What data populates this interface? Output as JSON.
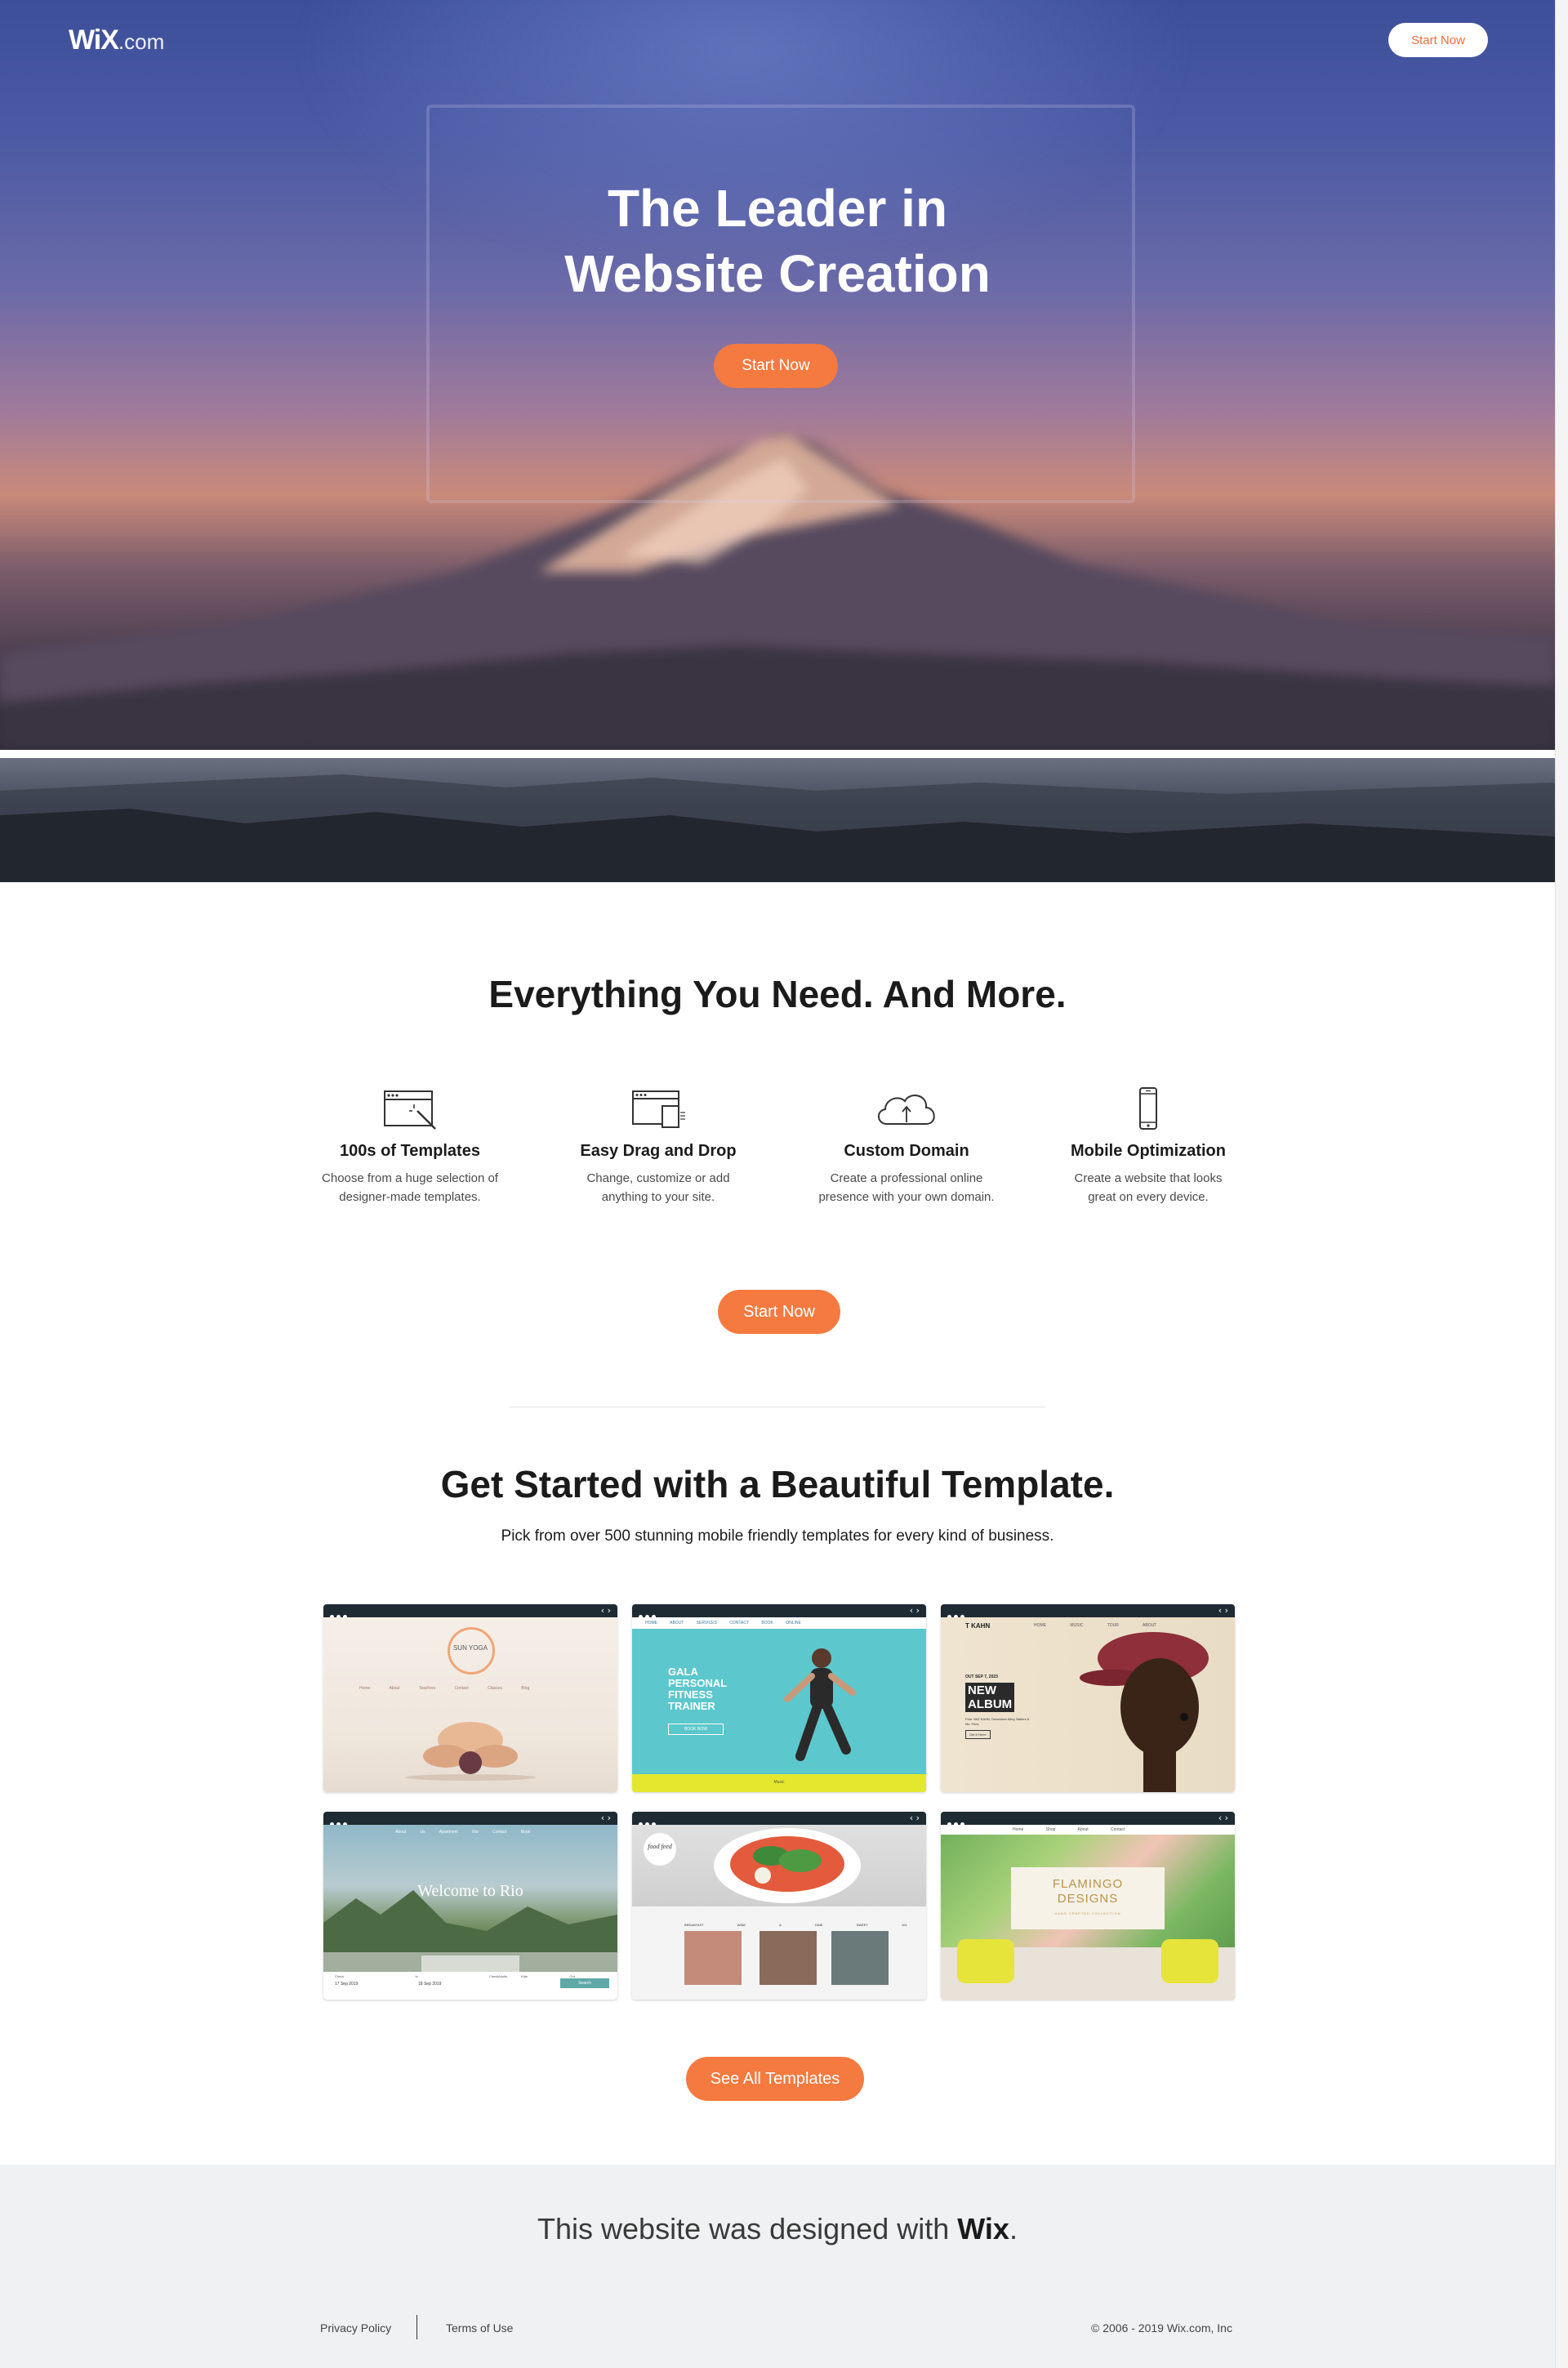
{
  "header": {
    "logo_main": "WiX",
    "logo_suffix": ".com",
    "start_button": "Start Now"
  },
  "hero": {
    "title_line1": "The Leader in",
    "title_line2": "Website Creation",
    "cta": "Start Now"
  },
  "features_section": {
    "heading": "Everything You Need. And More.",
    "items": [
      {
        "icon": "templates-icon",
        "title": "100s of Templates",
        "desc_line1": "Choose from a huge selection of",
        "desc_line2": "designer-made templates."
      },
      {
        "icon": "drag-drop-icon",
        "title": "Easy Drag and Drop",
        "desc_line1": "Change, customize or add",
        "desc_line2": "anything to your site."
      },
      {
        "icon": "cloud-upload-icon",
        "title": "Custom Domain",
        "desc_line1": "Create a professional online",
        "desc_line2": "presence with your own domain."
      },
      {
        "icon": "mobile-icon",
        "title": "Mobile Optimization",
        "desc_line1": "Create a website that looks",
        "desc_line2": "great on every device."
      }
    ],
    "cta": "Start Now"
  },
  "templates_section": {
    "heading": "Get Started with a Beautiful Template.",
    "subtitle": "Pick from over 500 stunning mobile friendly templates for every kind of business.",
    "templates": [
      {
        "name": "sun-yoga",
        "title": "SUN YOGA",
        "nav": [
          "Home",
          "About",
          "Teachers",
          "Contact",
          "Classes",
          "Blog"
        ]
      },
      {
        "name": "fitness-trainer",
        "title_lines": [
          "GALA",
          "PERSONAL",
          "FITNESS",
          "TRAINER"
        ],
        "nav": [
          "HOME",
          "ABOUT",
          "SERVICES",
          "CONTACT",
          "BOOK ONLINE"
        ],
        "button": "BOOK NOW",
        "footer": "Music"
      },
      {
        "name": "t-kahn",
        "brand": "T KAHN",
        "nav": [
          "HOME",
          "MUSIC",
          "TOUR",
          "ABOUT"
        ],
        "date": "OUT SEP 7, 2023",
        "title_lines": [
          "NEW",
          "ALBUM"
        ],
        "featuring": "Feat. WIZ KAHN, Drewdown Alley, Ballers & Ms. Fries",
        "button": "Get It Here!"
      },
      {
        "name": "rio",
        "title": "Welcome to Rio",
        "nav": [
          "About Us",
          "Apartment",
          "Rio",
          "Contact",
          "Book"
        ],
        "labels": [
          "Check In",
          "Check Out",
          "Adults",
          "Kids"
        ],
        "check_in": "17 Sep 2019",
        "check_out": "18 Sep 2019",
        "search": "Search"
      },
      {
        "name": "food-feed",
        "logo": "food feed",
        "labels": [
          "BREAKFAST",
          "WINE & DINE",
          "SWEET 101"
        ]
      },
      {
        "name": "flamingo",
        "title_lines": [
          "FLAMINGO",
          "DESIGNS"
        ],
        "subtitle": "HAND CRAFTED COLLECTION",
        "nav": [
          "Home",
          "Shop",
          "About",
          "Contact"
        ]
      }
    ],
    "cta": "See All Templates"
  },
  "footer": {
    "tagline_prefix": "This website was designed with ",
    "tagline_brand": "Wix",
    "tagline_suffix": ".",
    "privacy": "Privacy Policy",
    "terms": "Terms of Use",
    "copyright": "© 2006 - 2019 Wix.com, Inc"
  },
  "colors": {
    "accent": "#f47a40",
    "footer_bg": "#f0f1f3"
  }
}
